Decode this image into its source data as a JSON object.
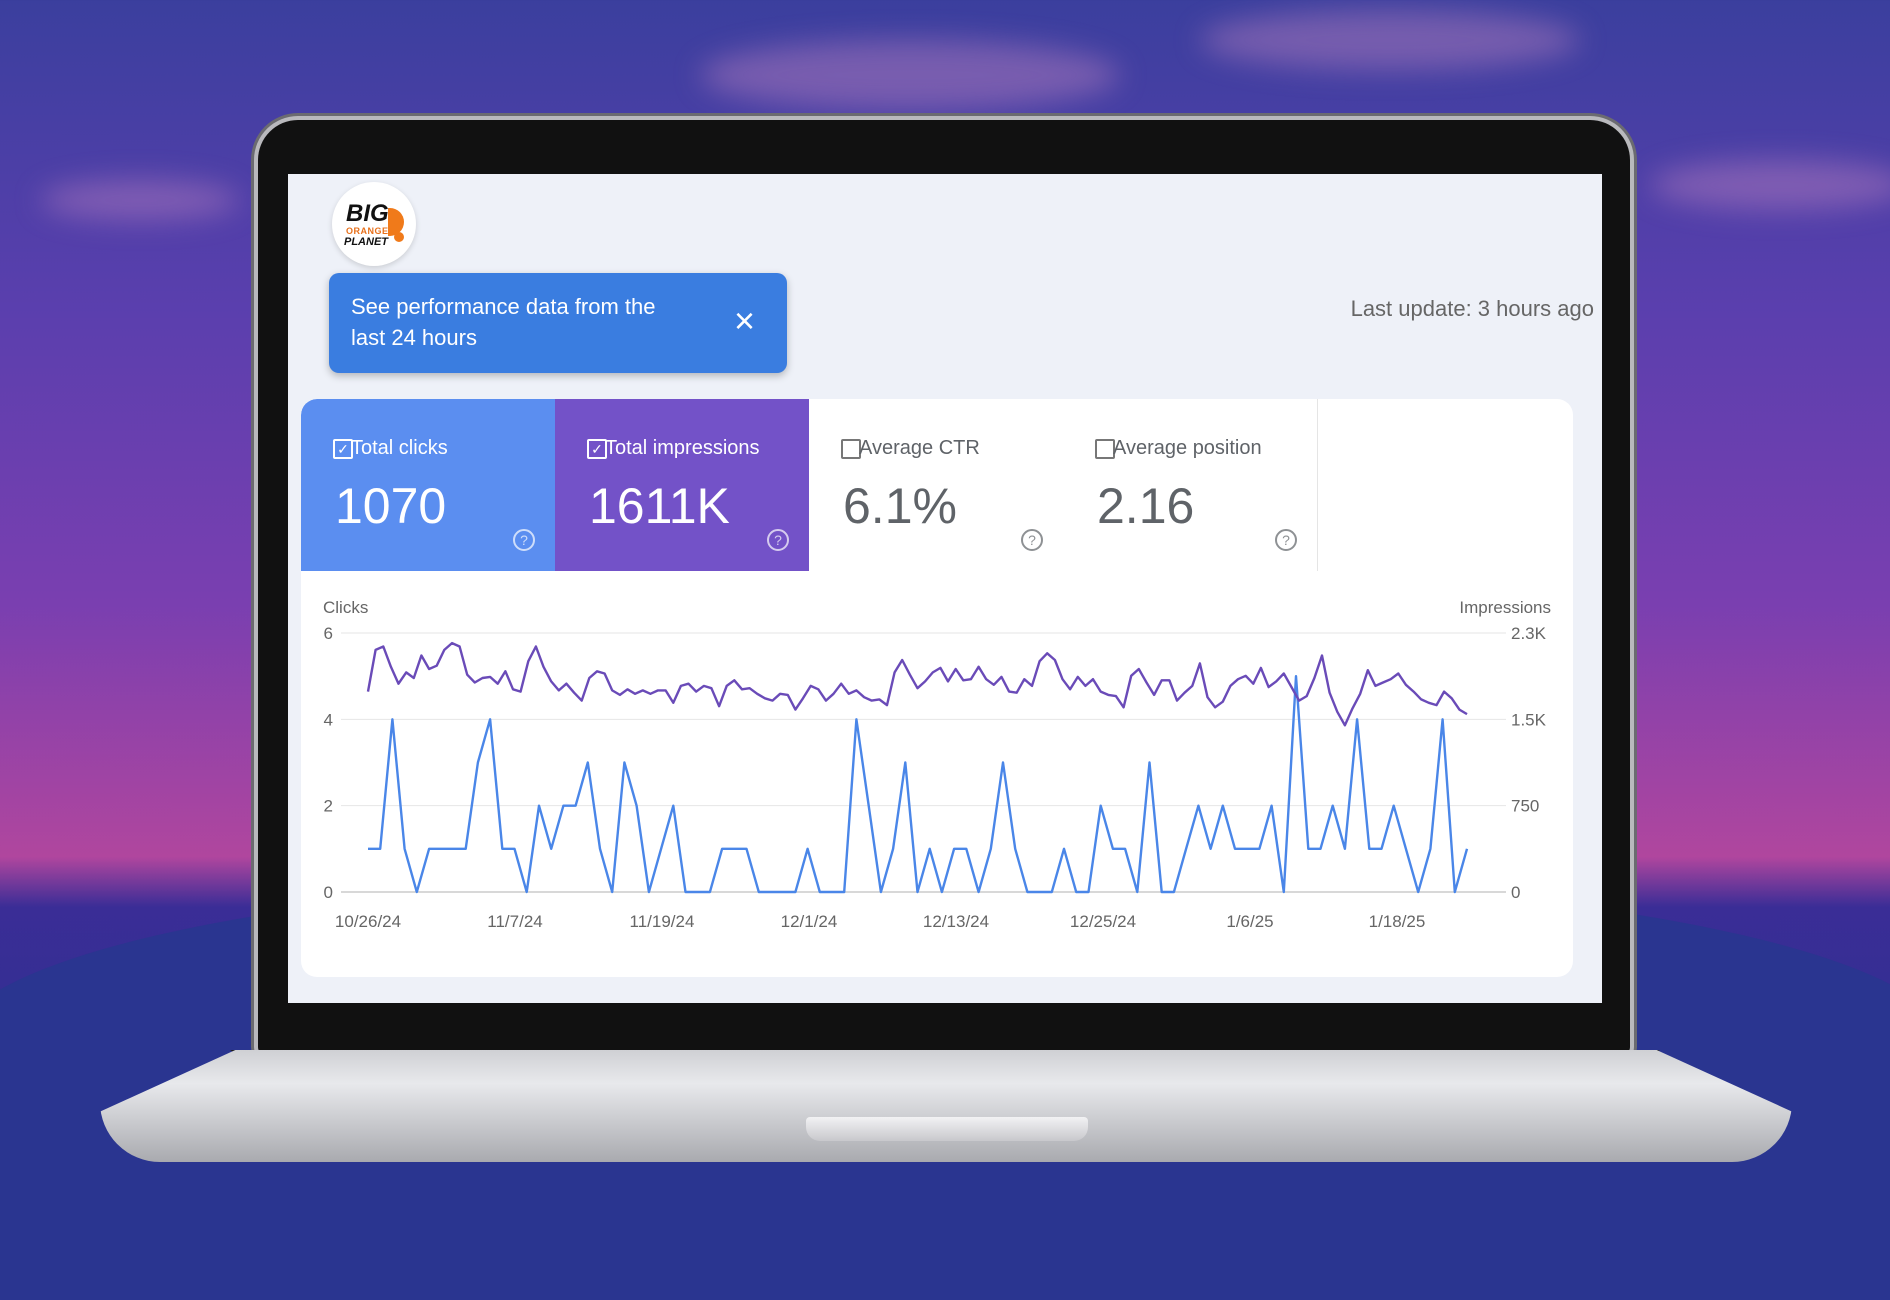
{
  "background": {
    "sky_top": "#3b3f9e",
    "sky_mid": "#7a3fb0",
    "horizon": "#b0469e"
  },
  "logo": {
    "line1": "BIG",
    "line2": "ORANGE",
    "line3": "PLANET"
  },
  "toast": {
    "text": "See performance data from the last 24 hours",
    "close_icon": "×",
    "color": "#3a7de0"
  },
  "last_update": "Last update: 3 hours ago",
  "metrics": [
    {
      "label": "Total clicks",
      "value": "1070",
      "checked": true,
      "color": "#5b8ef0"
    },
    {
      "label": "Total impressions",
      "value": "1611K",
      "checked": true,
      "color": "#7352c8"
    },
    {
      "label": "Average CTR",
      "value": "6.1%",
      "checked": false
    },
    {
      "label": "Average position",
      "value": "2.16",
      "checked": false
    }
  ],
  "chart_data": {
    "type": "line",
    "ylabel_left": "Clicks",
    "ylabel_right": "Impressions",
    "y_left_ticks": [
      "6",
      "4",
      "2",
      "0"
    ],
    "y_right_ticks": [
      "2.3K",
      "1.5K",
      "750",
      "0"
    ],
    "ylim_left": [
      0,
      6
    ],
    "ylim_right": [
      0,
      2300
    ],
    "x_ticks": [
      "10/26/24",
      "11/7/24",
      "11/19/24",
      "12/1/24",
      "12/13/24",
      "12/25/24",
      "1/6/25",
      "1/18/25"
    ],
    "grid": true,
    "series": [
      {
        "name": "Clicks",
        "axis": "left",
        "color": "#4a86e8",
        "values": [
          1,
          1,
          4,
          1,
          0,
          1,
          1,
          1,
          1,
          3,
          4,
          1,
          1,
          0,
          2,
          1,
          2,
          2,
          3,
          1,
          0,
          3,
          2,
          0,
          1,
          2,
          0,
          0,
          0,
          1,
          1,
          1,
          0,
          0,
          0,
          0,
          1,
          0,
          0,
          0,
          4,
          2,
          0,
          1,
          3,
          0,
          1,
          0,
          1,
          1,
          0,
          1,
          3,
          1,
          0,
          0,
          0,
          1,
          0,
          0,
          2,
          1,
          1,
          0,
          3,
          0,
          0,
          1,
          2,
          1,
          2,
          1,
          1,
          1,
          2,
          0,
          5,
          1,
          1,
          2,
          1,
          4,
          1,
          1,
          2,
          1,
          0,
          1,
          4,
          0,
          1
        ]
      },
      {
        "name": "Impressions",
        "axis": "right",
        "color": "#6a4bb8",
        "values": [
          1780,
          2150,
          2180,
          2000,
          1850,
          1950,
          1900,
          2100,
          1980,
          2010,
          2150,
          2210,
          2180,
          1930,
          1860,
          1900,
          1910,
          1850,
          1960,
          1800,
          1780,
          2050,
          2180,
          2000,
          1870,
          1790,
          1850,
          1770,
          1700,
          1900,
          1960,
          1940,
          1790,
          1750,
          1800,
          1760,
          1790,
          1760,
          1790,
          1790,
          1680,
          1830,
          1850,
          1780,
          1830,
          1810,
          1650,
          1830,
          1880,
          1800,
          1810,
          1760,
          1720,
          1700,
          1760,
          1750,
          1620,
          1720,
          1830,
          1800,
          1700,
          1760,
          1850,
          1760,
          1790,
          1730,
          1700,
          1710,
          1660,
          1950,
          2060,
          1930,
          1810,
          1870,
          1950,
          1990,
          1870,
          1980,
          1880,
          1890,
          2000,
          1890,
          1840,
          1910,
          1780,
          1770,
          1890,
          1830,
          2050,
          2120,
          2060,
          1890,
          1800,
          1910,
          1830,
          1890,
          1780,
          1750,
          1740,
          1640,
          1920,
          1980,
          1860,
          1750,
          1880,
          1880,
          1700,
          1770,
          1830,
          2030,
          1730,
          1640,
          1690,
          1830,
          1890,
          1920,
          1850,
          1990,
          1820,
          1870,
          1940,
          1820,
          1700,
          1740,
          1900,
          2100,
          1770,
          1600,
          1480,
          1630,
          1760,
          1970,
          1830,
          1860,
          1890,
          1940,
          1840,
          1780,
          1710,
          1680,
          1660,
          1780,
          1720,
          1620,
          1580
        ]
      }
    ]
  }
}
